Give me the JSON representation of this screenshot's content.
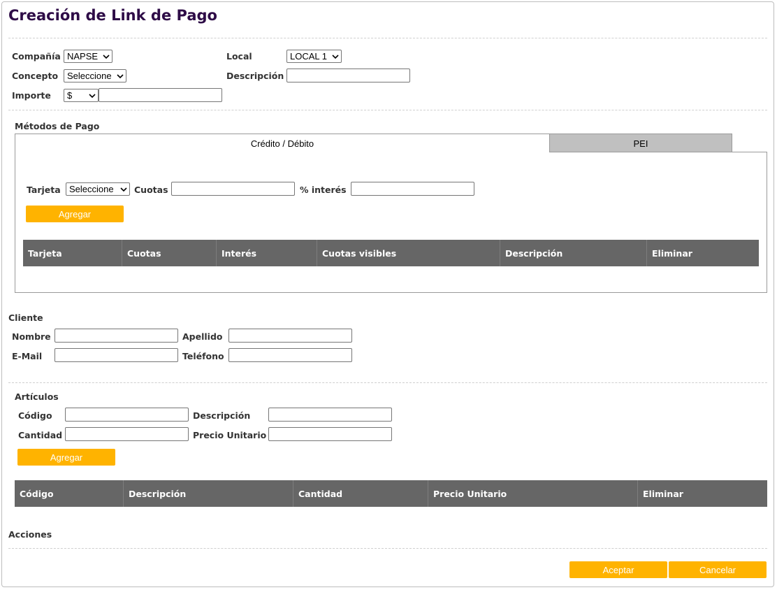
{
  "page": {
    "title": "Creación de Link de Pago"
  },
  "header_form": {
    "compania": {
      "label": "Compañía",
      "value": "NAPSE"
    },
    "local": {
      "label": "Local",
      "value": "LOCAL 1"
    },
    "concepto": {
      "label": "Concepto",
      "value": "Seleccione"
    },
    "descripcion": {
      "label": "Descripción",
      "value": ""
    },
    "importe": {
      "label": "Importe",
      "currency": "$",
      "value": ""
    }
  },
  "metodos_pago": {
    "section_label": "Métodos de Pago",
    "tabs": [
      {
        "label": "Crédito / Débito",
        "active": true
      },
      {
        "label": "PEI",
        "active": false
      }
    ],
    "tarjeta": {
      "label": "Tarjeta",
      "value": "Seleccione"
    },
    "cuotas": {
      "label": "Cuotas",
      "value": ""
    },
    "interes": {
      "label": "% interés",
      "value": ""
    },
    "add_button": "Agregar",
    "table_headers": [
      "Tarjeta",
      "Cuotas",
      "Interés",
      "Cuotas visibles",
      "Descripción",
      "Eliminar"
    ]
  },
  "cliente": {
    "section_label": "Cliente",
    "nombre": {
      "label": "Nombre",
      "value": ""
    },
    "apellido": {
      "label": "Apellido",
      "value": ""
    },
    "email": {
      "label": "E-Mail",
      "value": ""
    },
    "telefono": {
      "label": "Teléfono",
      "value": ""
    }
  },
  "articulos": {
    "section_label": "Artículos",
    "codigo": {
      "label": "Código",
      "value": ""
    },
    "descripcion": {
      "label": "Descripción",
      "value": ""
    },
    "cantidad": {
      "label": "Cantidad",
      "value": ""
    },
    "precio_unitario": {
      "label": "Precio Unitario",
      "value": ""
    },
    "add_button": "Agregar",
    "table_headers": [
      "Código",
      "Descripción",
      "Cantidad",
      "Precio Unitario",
      "Eliminar"
    ]
  },
  "acciones": {
    "section_label": "Acciones",
    "accept_button": "Aceptar",
    "cancel_button": "Cancelar"
  },
  "colors": {
    "title": "#2e0c47",
    "button_bg": "#ffb300",
    "table_header_bg": "#666666",
    "inactive_tab_bg": "#c0c0c0"
  }
}
